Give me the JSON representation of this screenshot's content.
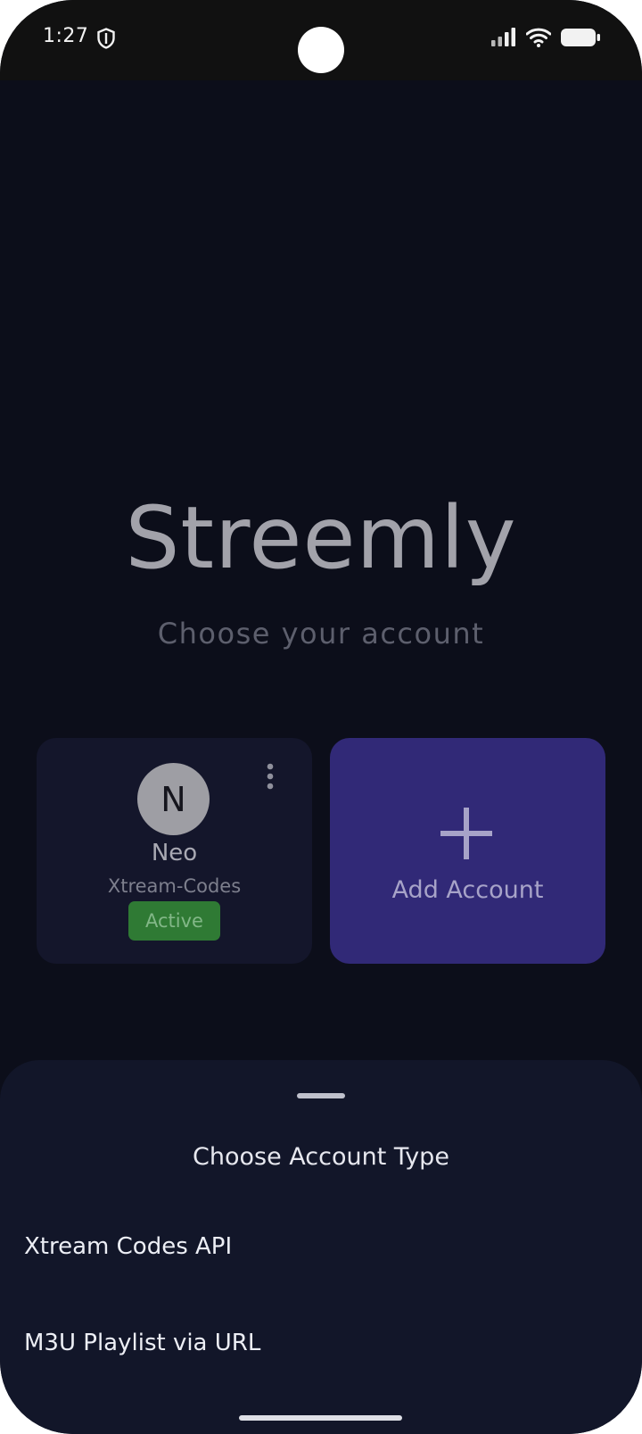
{
  "status_bar": {
    "time": "1:27",
    "icons": [
      "shield-icon",
      "signal-icon",
      "wifi-icon",
      "battery-icon"
    ]
  },
  "app": {
    "title": "Streemly",
    "subtitle": "Choose your account"
  },
  "accounts": [
    {
      "initial": "N",
      "name": "Neo",
      "type": "Xtream-Codes",
      "status": "Active"
    }
  ],
  "add_account": {
    "label": "Add Account",
    "icon": "plus-icon"
  },
  "sheet": {
    "title": "Choose Account Type",
    "options": [
      {
        "label": "Xtream Codes API"
      },
      {
        "label": "M3U Playlist via URL"
      }
    ]
  },
  "colors": {
    "background": "#0c0e1a",
    "card": "#14162b",
    "add_card": "#312977",
    "active_badge": "#2f7a34",
    "sheet": "#121629"
  }
}
